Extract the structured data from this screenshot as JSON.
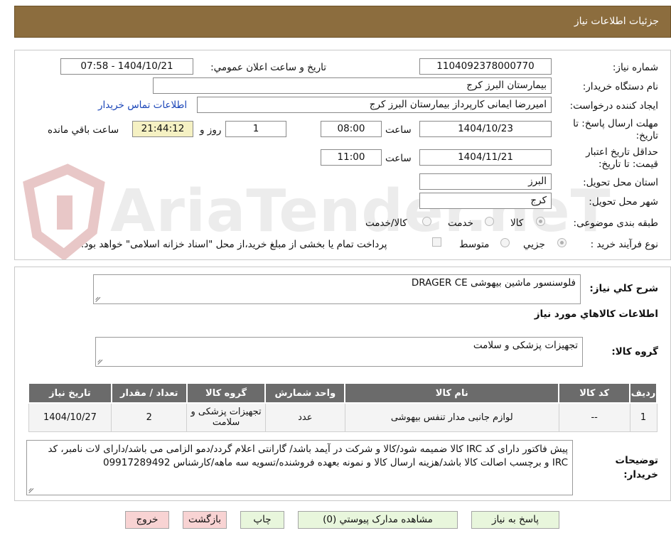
{
  "header": {
    "title": "جزئیات اطلاعات نیاز"
  },
  "watermark": "AriaTender.neT",
  "form": {
    "need_number_label": "شماره نیاز:",
    "need_number": "1104092378000770",
    "announce_label": "تاریخ و ساعت اعلان عمومي:",
    "announce_value": "1404/10/21 - 07:58",
    "buyer_org_label": "نام دستگاه خريدار:",
    "buyer_org": "بیمارستان البرز کرج",
    "requester_label": "ايجاد كننده درخواست:",
    "requester": "امیررضا ایمانی کارپرداز بیمارستان البرز کرج",
    "contact_link": "اطلاعات تماس خریدار",
    "deadline_label": "مهلت ارسال پاسخ: تا تاریخ:",
    "deadline_date": "1404/10/23",
    "time_label": "ساعت",
    "deadline_time": "08:00",
    "days_value": "1",
    "days_label": "روز و",
    "remaining_time": "21:44:12",
    "remaining_label": "ساعت باقي مانده",
    "validity_label": "حداقل تاريخ اعتبار قیمت: تا تاریخ:",
    "validity_date": "1404/11/21",
    "validity_time": "11:00",
    "province_label": "استان محل تحويل:",
    "province": "البرز",
    "city_label": "شهر محل تحويل:",
    "city": "کرج",
    "category_label": "طبقه بندی موضوعی:",
    "category_options": [
      "کالا",
      "خدمت",
      "کالا/خدمت"
    ],
    "process_label": "نوع فرآيند خريد :",
    "process_options": [
      "جزيي",
      "متوسط"
    ],
    "payment_note": "پرداخت تمام یا بخشی از مبلغ خرید،از محل \"اسناد خزانه اسلامی\" خواهد بود."
  },
  "details": {
    "summary_label": "شرح كلي نياز:",
    "summary": "فلوسنسور ماشین بیهوشی DRAGER CE",
    "items_title": "اطلاعات كالاهاي مورد نياز",
    "group_label": "گروه كالا:",
    "group": "تجهیزات پزشکی و سلامت",
    "table": {
      "headers": [
        "رديف",
        "كد كالا",
        "نام كالا",
        "واحد شمارش",
        "گروه كالا",
        "تعداد / مقدار",
        "تاريخ نياز"
      ],
      "rows": [
        [
          "1",
          "--",
          "لوازم جانبی مدار تنفس بیهوشی",
          "عدد",
          "تجهیزات پزشکی و سلامت",
          "2",
          "1404/10/27"
        ]
      ]
    },
    "buyer_notes_label": "توضيحات خريدار:",
    "buyer_notes": "پیش فاکتور دارای کد IRC کالا ضمیمه شود/کالا و شرکت در آیمد باشد/ گارانتی اعلام گردد/دمو الزامی می باشد/دارای لات نامبر، کد IRC و برچسب اصالت کالا باشد/هزینه ارسال کالا و نمونه بعهده فروشنده/تسویه سه ماهه/کارشناس 09917289492"
  },
  "buttons": {
    "reply": "پاسخ به نياز",
    "attachments": "مشاهده مدارک پیوستي (0)",
    "print": "چاپ",
    "back": "بازگشت",
    "exit": "خروج"
  },
  "colors": {
    "header_bg": "#8c6d3e",
    "table_header": "#6b6b6b",
    "link": "#1a45b8"
  }
}
